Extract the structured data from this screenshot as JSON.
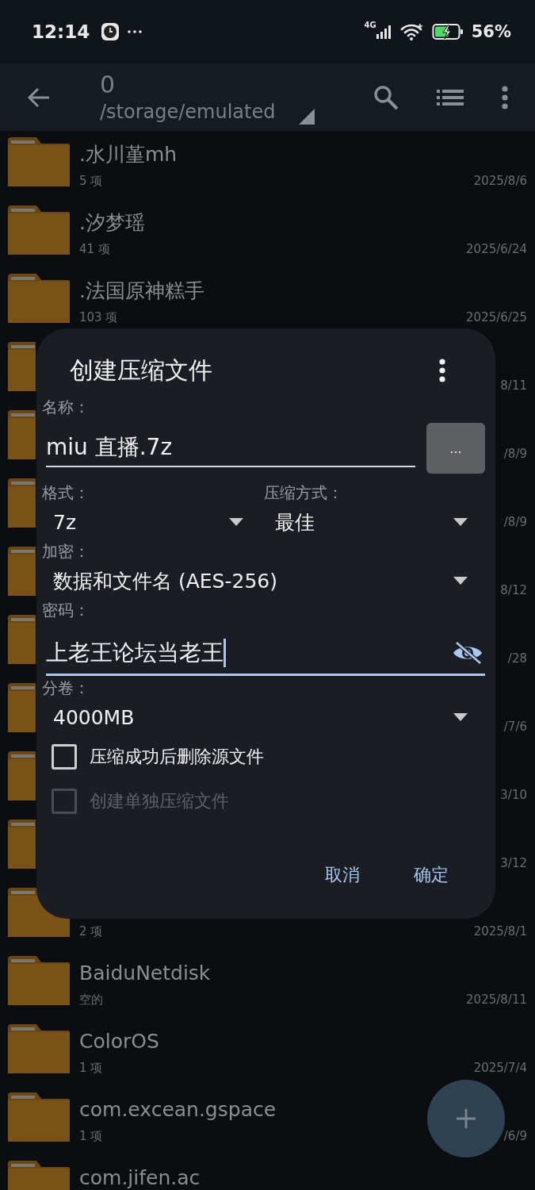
{
  "status_bar": {
    "time": "12:14",
    "network": "4G",
    "battery": "56%"
  },
  "app_bar": {
    "title": "0",
    "path": "/storage/emulated"
  },
  "files": [
    {
      "name": ".水川堇mh",
      "count": "5 项",
      "date": "2025/8/6"
    },
    {
      "name": ".汐梦瑶",
      "count": "41 项",
      "date": "2025/6/24"
    },
    {
      "name": ".法国原神糕手",
      "count": "103 项",
      "date": "2025/6/25"
    },
    {
      "date": "8/11"
    },
    {
      "date": "/8/9"
    },
    {
      "date": "/8/9"
    },
    {
      "date": "8/12"
    },
    {
      "date": "/28"
    },
    {
      "date": "/7/6"
    },
    {
      "date": "3/10"
    },
    {
      "date": "3/12"
    },
    {
      "count": "2 项",
      "date": "2025/8/1"
    },
    {
      "name": "BaiduNetdisk",
      "count": "空的",
      "date": "2025/8/11"
    },
    {
      "name": "ColorOS",
      "count": "1 项",
      "date": "2025/7/4"
    },
    {
      "name": "com.excean.gspace",
      "count": "1 项",
      "date": "/6/9"
    },
    {
      "name": "com.jifen.ac"
    }
  ],
  "dialog": {
    "title": "创建压缩文件",
    "name_label": "名称：",
    "name_value": "miu 直播.7z",
    "name_focused": false,
    "browse_button": "...",
    "format_label": "格式：",
    "format_value": "7z",
    "method_label": "压缩方式：",
    "method_value": "最佳",
    "encryption_label": "加密：",
    "encryption_value": "数据和文件名 (AES-256)",
    "password_label": "密码：",
    "password_value": "上老王论坛当老王",
    "password_focused": true,
    "split_label": "分卷：",
    "split_value": "4000MB",
    "options": [
      {
        "label": "压缩成功后删除源文件",
        "checked": false,
        "disabled": false
      },
      {
        "label": "创建单独压缩文件",
        "checked": false,
        "disabled": true
      }
    ],
    "buttons": [
      "取消",
      "确定"
    ]
  }
}
